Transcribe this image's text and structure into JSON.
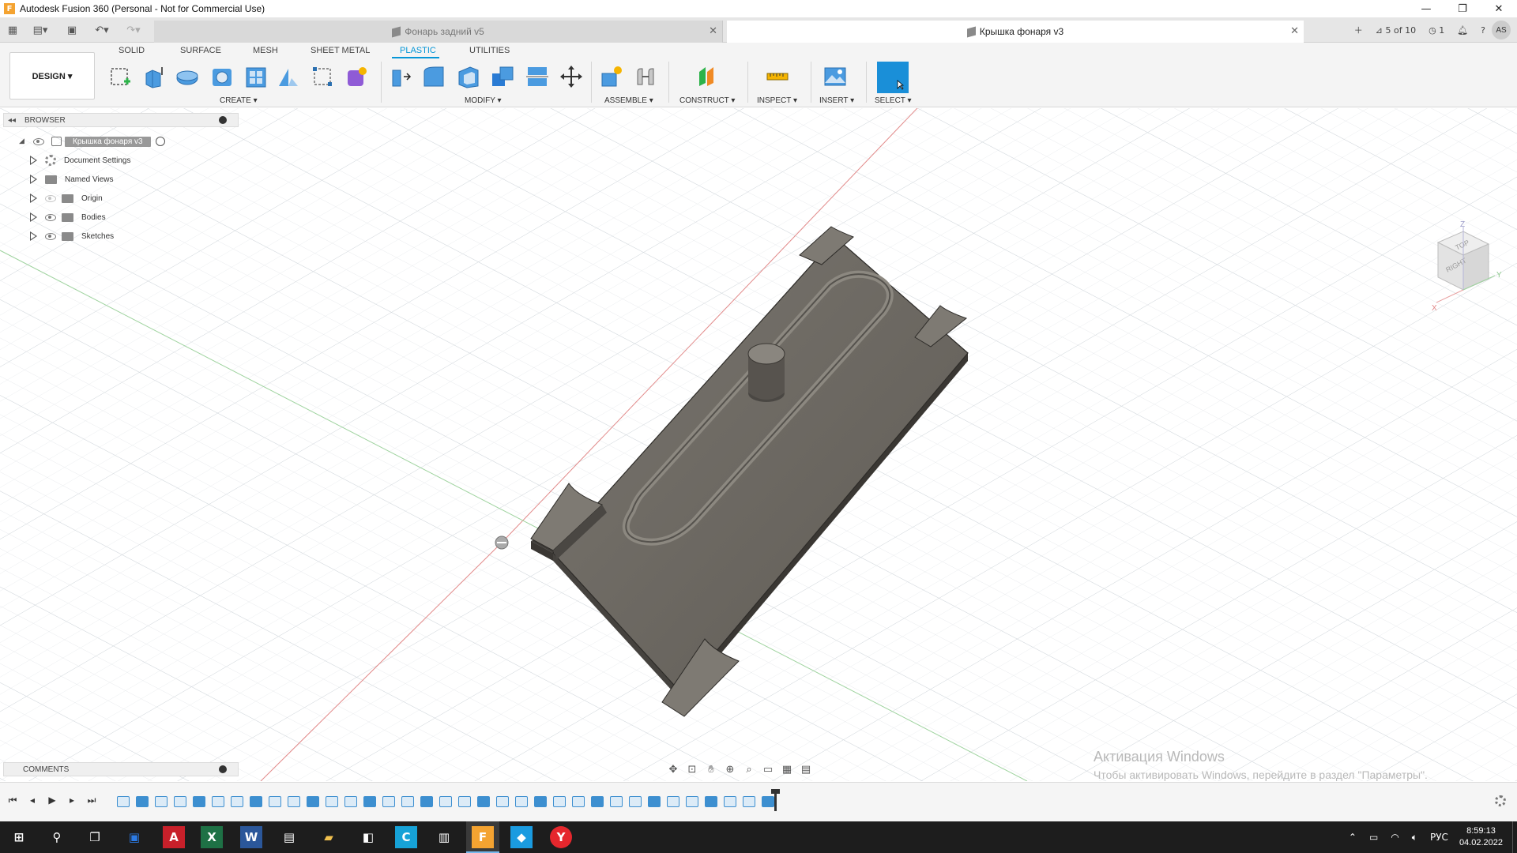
{
  "window": {
    "title": "Autodesk Fusion 360 (Personal - Not for Commercial Use)",
    "app_icon_letter": "F",
    "minimize": "—",
    "restore": "❐",
    "close": "✕"
  },
  "tabs": {
    "inactive_tab": "Фонарь задний v5",
    "active_tab": "Крышка фонаря v3",
    "version_count": "5 of 10",
    "jobs_count": "1",
    "user_initials": "AS"
  },
  "toolbar": {
    "design_label": "DESIGN ▾",
    "workspace_tabs": [
      "SOLID",
      "SURFACE",
      "MESH",
      "SHEET METAL",
      "PLASTIC",
      "UTILITIES"
    ],
    "active_workspace": "PLASTIC",
    "groups": {
      "create": "CREATE ▾",
      "modify": "MODIFY ▾",
      "assemble": "ASSEMBLE ▾",
      "construct": "CONSTRUCT ▾",
      "inspect": "INSPECT ▾",
      "insert": "INSERT ▾",
      "select": "SELECT ▾"
    }
  },
  "browser": {
    "title": "BROWSER",
    "root": "Крышка фонаря v3",
    "items": [
      {
        "label": "Document Settings",
        "icon": "gear-icon"
      },
      {
        "label": "Named Views",
        "icon": "folder-icon"
      },
      {
        "label": "Origin",
        "icon": "folder-icon",
        "visible": false
      },
      {
        "label": "Bodies",
        "icon": "folder-icon",
        "visible": true
      },
      {
        "label": "Sketches",
        "icon": "folder-icon",
        "visible": true
      }
    ]
  },
  "comments": {
    "title": "COMMENTS"
  },
  "viewcube": {
    "face": "RIGHT",
    "top_face": "TOP",
    "axes": [
      "Z",
      "X",
      "Y"
    ]
  },
  "watermark": {
    "line1": "Активация Windows",
    "line2": "Чтобы активировать Windows, перейдите в раздел \"Параметры\"."
  },
  "taskbar": {
    "lang": "РУС",
    "time": "8:59:13",
    "date": "04.02.2022"
  },
  "colors": {
    "accent": "#0696d7",
    "model": "#6f6b64",
    "grid": "#d8dde2"
  }
}
